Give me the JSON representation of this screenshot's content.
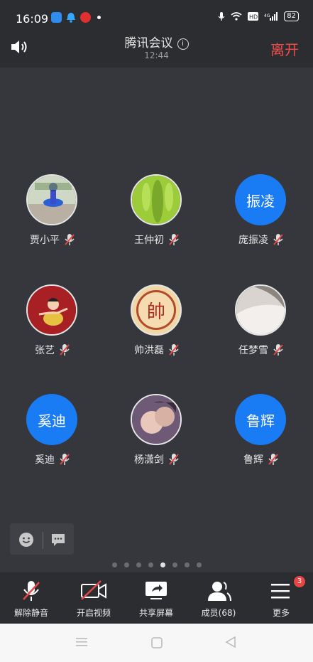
{
  "status_bar": {
    "time": "16:09",
    "battery": "82"
  },
  "header": {
    "title": "腾讯会议",
    "subtitle": "12:44",
    "leave_label": "离开"
  },
  "participants": [
    {
      "name": "贾小平",
      "avatar_text": ""
    },
    {
      "name": "王仲初",
      "avatar_text": ""
    },
    {
      "name": "庞振凌",
      "avatar_text": "振凌"
    },
    {
      "name": "张艺",
      "avatar_text": ""
    },
    {
      "name": "帅洪磊",
      "avatar_text": "帥"
    },
    {
      "name": "任梦雪",
      "avatar_text": ""
    },
    {
      "name": "奚迪",
      "avatar_text": "奚迪"
    },
    {
      "name": "杨潇剑",
      "avatar_text": ""
    },
    {
      "name": "鲁辉",
      "avatar_text": "鲁辉"
    }
  ],
  "pager": {
    "count": 8,
    "active_index": 4
  },
  "toolbar": {
    "unmute_label": "解除静音",
    "video_label": "开启视频",
    "share_label": "共享屏幕",
    "members_label": "成员(68)",
    "more_label": "更多",
    "more_badge": "3"
  },
  "colors": {
    "accent_blue": "#1a7cf5",
    "leave_red": "#f04b48",
    "muted_red": "#e84545"
  }
}
